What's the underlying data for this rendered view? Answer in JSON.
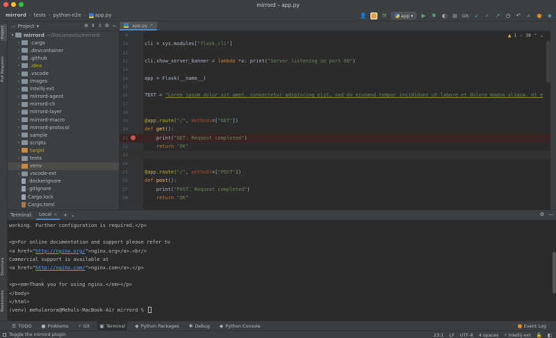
{
  "window": {
    "title": "mirrord – app.py"
  },
  "breadcrumbs": [
    "mirrord",
    "tests",
    "python-e2e",
    "app.py"
  ],
  "toolbar": {
    "run_config": "app",
    "git_label": "Git:"
  },
  "left_strip": [
    "Project",
    "Pull Requests",
    "Structure",
    "Bookmarks"
  ],
  "project_panel": {
    "title": "Project",
    "root_name": "mirrord",
    "root_path": "~/Documents/mirrord",
    "items": [
      {
        "name": ".cargo",
        "kind": "folder",
        "color": "normal"
      },
      {
        "name": ".devcontainer",
        "kind": "folder",
        "color": "normal"
      },
      {
        "name": ".github",
        "kind": "folder",
        "color": "normal"
      },
      {
        "name": ".idea",
        "kind": "folder",
        "color": "yellow"
      },
      {
        "name": ".vscode",
        "kind": "folder",
        "color": "normal"
      },
      {
        "name": "images",
        "kind": "folder",
        "color": "normal"
      },
      {
        "name": "intellij-ext",
        "kind": "folder",
        "color": "normal"
      },
      {
        "name": "mirrord-agent",
        "kind": "folder",
        "color": "normal"
      },
      {
        "name": "mirrord-cli",
        "kind": "folder",
        "color": "normal"
      },
      {
        "name": "mirrord-layer",
        "kind": "folder",
        "color": "normal"
      },
      {
        "name": "mirrord-macro",
        "kind": "folder",
        "color": "normal"
      },
      {
        "name": "mirrord-protocol",
        "kind": "folder",
        "color": "normal"
      },
      {
        "name": "sample",
        "kind": "folder",
        "color": "normal"
      },
      {
        "name": "scripts",
        "kind": "folder",
        "color": "normal"
      },
      {
        "name": "target",
        "kind": "folder-orange",
        "color": "yellow"
      },
      {
        "name": "tests",
        "kind": "folder",
        "color": "normal"
      },
      {
        "name": "venv",
        "kind": "folder-orange",
        "color": "normal",
        "selected": true
      },
      {
        "name": "vscode-ext",
        "kind": "folder",
        "color": "normal"
      },
      {
        "name": ".dockerignore",
        "kind": "file",
        "color": "normal"
      },
      {
        "name": ".gitignore",
        "kind": "file",
        "color": "normal"
      },
      {
        "name": "Cargo.lock",
        "kind": "file",
        "color": "normal"
      },
      {
        "name": "Cargo.toml",
        "kind": "file-toml",
        "color": "normal"
      }
    ]
  },
  "editor": {
    "tab": "app.py",
    "inspections": {
      "warnings": "1",
      "ok": "38"
    },
    "lines": [
      {
        "n": "9",
        "html": ""
      },
      {
        "n": "10",
        "html": "<span>cli = sys.modules[</span><span class='str'>\"flask.cli\"</span><span>]</span>"
      },
      {
        "n": "11",
        "html": ""
      },
      {
        "n": "12",
        "html": "<span>cli.show_server_banner = </span><span class='kw'>lambda </span><span>*x: print(</span><span class='str'>\"Server listening on port 80\"</span><span>)</span>"
      },
      {
        "n": "13",
        "html": ""
      },
      {
        "n": "14",
        "html": "<span>app = Flask(__name__)</span>"
      },
      {
        "n": "15",
        "html": ""
      },
      {
        "n": "16",
        "html": "<span>TEXT = </span><span class='ulstr'>\"Lorem ipsum dolor sit amet, consectetur adipiscing elit, sed do eiusmod tempor incididunt ut labore et dolore magna aliqua. Ut e</span>"
      },
      {
        "n": "17",
        "html": ""
      },
      {
        "n": "18",
        "html": ""
      },
      {
        "n": "19",
        "html": "<span class='dec'>@app.route(</span><span class='str'>\"/\"</span><span>, </span><span class='param'>methods</span><span>=[</span><span class='str'>\"GET\"</span><span>])</span>"
      },
      {
        "n": "20",
        "html": "<span class='kw'>def </span><span class='fn'>get</span><span>():</span>"
      },
      {
        "n": "21",
        "html": "<span>    print(</span><span class='str'>\"GET: Request completed\"</span><span>)</span>",
        "breakpoint": true
      },
      {
        "n": "22",
        "html": "<span>    </span><span class='kw'>return </span><span class='str'>\"OK\"</span>"
      },
      {
        "n": "23",
        "html": "",
        "current": true
      },
      {
        "n": "24",
        "html": ""
      },
      {
        "n": "25",
        "html": "<span class='dec'>@app.route(</span><span class='str'>\"/\"</span><span>, </span><span class='param'>methods</span><span>=[</span><span class='str'>\"POST\"</span><span>])</span>"
      },
      {
        "n": "26",
        "html": "<span class='kw'>def </span><span class='fn'>post</span><span>():</span>"
      },
      {
        "n": "27",
        "html": "<span>    print(</span><span class='str'>\"POST: Request completed\"</span><span>)</span>"
      },
      {
        "n": "28",
        "html": "<span>    </span><span class='kw'>return </span><span class='str'>\"OK\"</span>"
      }
    ]
  },
  "terminal": {
    "title": "Terminal:",
    "tab": "Local",
    "lines": [
      {
        "html": "working. Further configuration is required.&lt;/p&gt;"
      },
      {
        "html": ""
      },
      {
        "html": "&lt;p&gt;For online documentation and support please refer to"
      },
      {
        "html": "&lt;a href=\"<span class='link'>http://nginx.org/</span>\"&gt;nginx.org&lt;/a&gt;.&lt;br/&gt;"
      },
      {
        "html": "Commercial support is available at"
      },
      {
        "html": "&lt;a href=\"<span class='link'>http://nginx.com/</span>\"&gt;nginx.com&lt;/a&gt;.&lt;/p&gt;"
      },
      {
        "html": ""
      },
      {
        "html": "&lt;p&gt;&lt;em&gt;Thank you for using nginx.&lt;/em&gt;&lt;/p&gt;"
      },
      {
        "html": "&lt;/body&gt;"
      },
      {
        "html": "&lt;/html&gt;"
      },
      {
        "html": "(venv) mehularora@Mehuls-MacBook-Air mirrord % <span class='cursor'></span>"
      }
    ]
  },
  "bottom_tools": {
    "items": [
      {
        "icon": "☰",
        "label": "TODO"
      },
      {
        "icon": "●",
        "label": "Problems"
      },
      {
        "icon": "⑂",
        "label": "Git"
      },
      {
        "icon": "▣",
        "label": "Terminal",
        "active": true
      },
      {
        "icon": "◆",
        "label": "Python Packages"
      },
      {
        "icon": "✱",
        "label": "Debug"
      },
      {
        "icon": "◆",
        "label": "Python Console"
      }
    ],
    "event_log": "Event Log"
  },
  "statusbar": {
    "message": "Toggle the mirrord plugin",
    "position": "23:1",
    "line_sep": "LF",
    "encoding": "UTF-8",
    "indent": "4 spaces",
    "branch": "intellij-ext"
  }
}
